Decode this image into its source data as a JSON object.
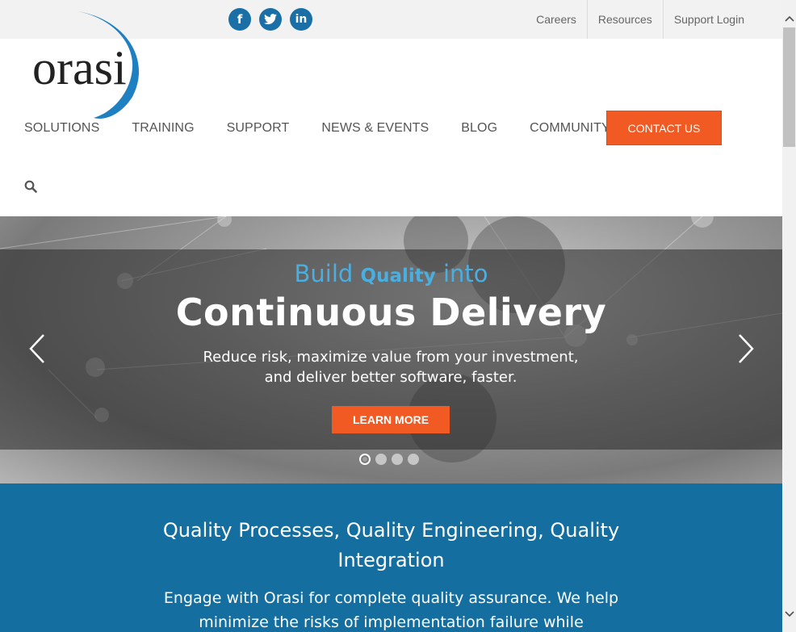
{
  "social": [
    {
      "name": "facebook-icon",
      "glyph": "f"
    },
    {
      "name": "twitter-icon",
      "glyph": "t"
    },
    {
      "name": "linkedin-icon",
      "glyph": "in"
    }
  ],
  "top_links": [
    "Careers",
    "Resources",
    "Support Login"
  ],
  "logo_text": "orasi",
  "nav": [
    "SOLUTIONS",
    "TRAINING",
    "SUPPORT",
    "NEWS & EVENTS",
    "BLOG",
    "COMMUNITY"
  ],
  "contact_label": "CONTACT US",
  "hero": {
    "pre": "Build",
    "pre_em": "Quality",
    "pre_post": "into",
    "title": "Continuous Delivery",
    "text_line1": "Reduce risk, maximize value from your investment,",
    "text_line2": "and deliver better software, faster.",
    "button": "LEARN MORE",
    "slides": 4,
    "active_slide": 1
  },
  "band": {
    "title_line1": "Quality Processes, Quality Engineering, Quality",
    "title_line2": "Integration",
    "text_line1": "Engage with Orasi for complete quality assurance. We help",
    "text_line2": "minimize the risks of implementation failure while accelerating"
  },
  "colors": {
    "brand_blue": "#146fa0",
    "accent_orange": "#f15a22",
    "hero_subtitle": "#4aaee0"
  }
}
